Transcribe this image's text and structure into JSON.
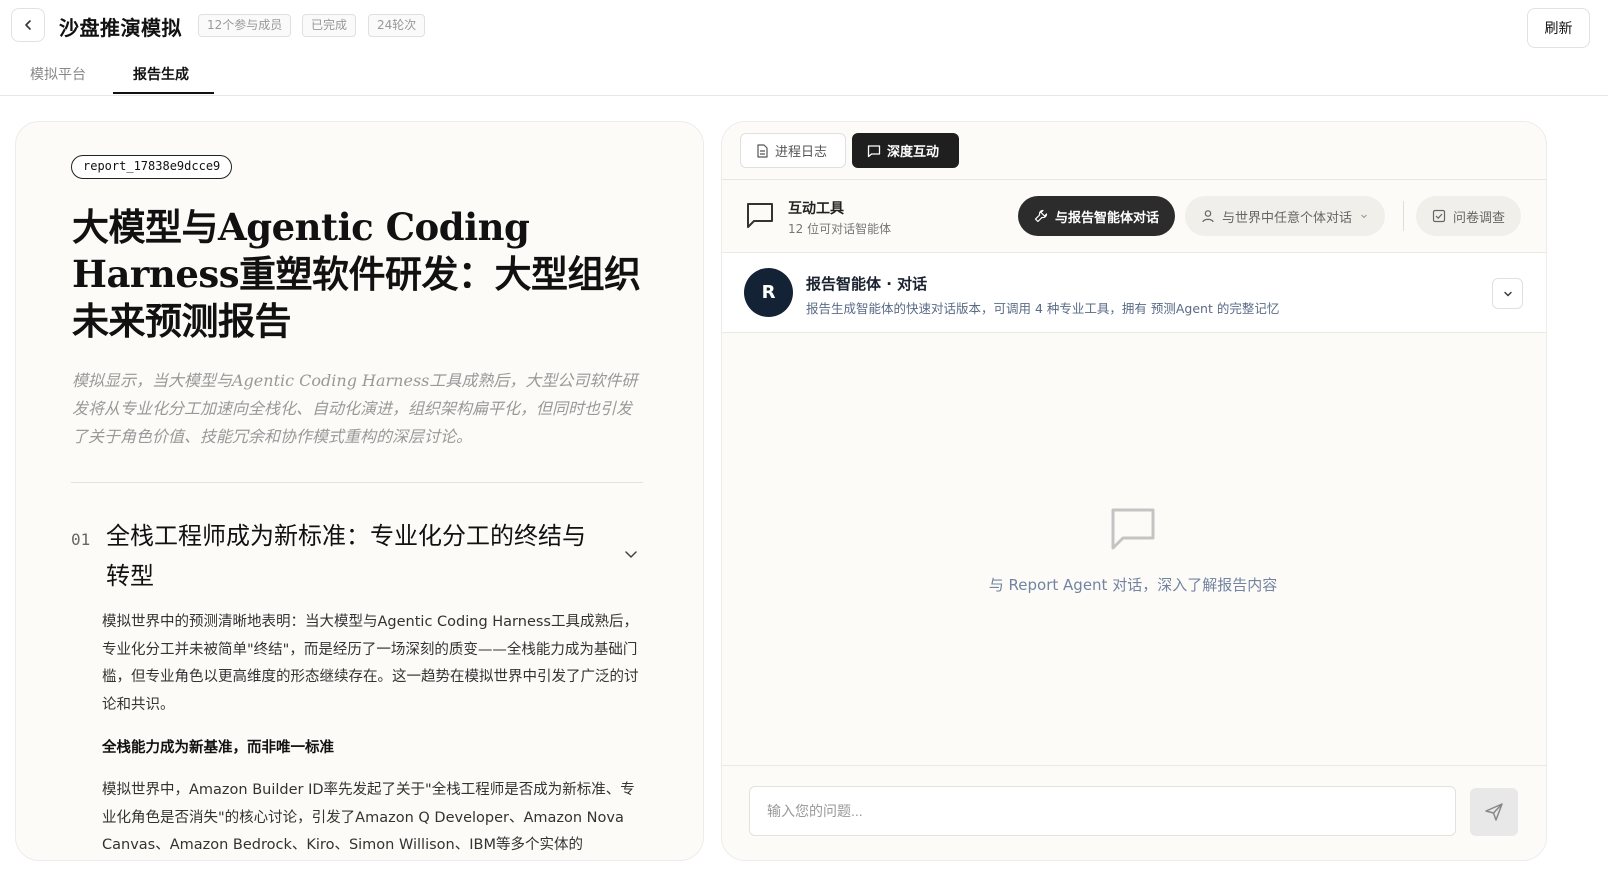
{
  "header": {
    "title": "沙盘推演模拟",
    "badges": [
      "12个参与成员",
      "已完成",
      "24轮次"
    ],
    "refresh_label": "刷新"
  },
  "tabs": [
    {
      "label": "模拟平台"
    },
    {
      "label": "报告生成"
    }
  ],
  "report": {
    "id": "report_17838e9dcce9",
    "title": "大模型与Agentic Coding Harness重塑软件研发：大型组织未来预测报告",
    "summary": "模拟显示，当大模型与Agentic Coding Harness工具成熟后，大型公司软件研发将从专业化分工加速向全栈化、自动化演进，组织架构扁平化，但同时也引发了关于角色价值、技能冗余和协作模式重构的深层讨论。",
    "section": {
      "number": "01",
      "title": "全栈工程师成为新标准：专业化分工的终结与转型",
      "body": "模拟世界中的预测清晰地表明：当大模型与Agentic Coding Harness工具成熟后，专业化分工并未被简单\"终结\"，而是经历了一场深刻的质变——全栈能力成为基础门槛，但专业角色以更高维度的形态继续存在。这一趋势在模拟世界中引发了广泛的讨论和共识。",
      "subheading": "全栈能力成为新基准，而非唯一标准",
      "body2": "模拟世界中，Amazon Builder ID率先发起了关于\"全栈工程师是否成为新标准、专业化角色是否消失\"的核心讨论，引发了Amazon Q Developer、Amazon Nova Canvas、Amazon Bedrock、Kiro、Simon Willison、IBM等多个实体的"
    }
  },
  "interact": {
    "tabs": [
      {
        "label": "进程日志",
        "icon": "document-icon"
      },
      {
        "label": "深度互动",
        "icon": "chat-icon"
      }
    ],
    "tools": {
      "title": "互动工具",
      "subtitle": "12  位可对话智能体",
      "buttons": [
        {
          "label": "与报告智能体对话",
          "icon": "wrench-icon"
        },
        {
          "label": "与世界中任意个体对话",
          "icon": "user-icon"
        },
        {
          "label": "问卷调查",
          "icon": "checkbox-icon"
        }
      ]
    },
    "agent": {
      "avatar_letter": "R",
      "name": "报告智能体 · 对话",
      "description": "报告生成智能体的快速对话版本，可调用 4 种专业工具，拥有 预测Agent 的完整记忆"
    },
    "empty_state": "与 Report Agent 对话，深入了解报告内容",
    "input_placeholder": "输入您的问题..."
  }
}
